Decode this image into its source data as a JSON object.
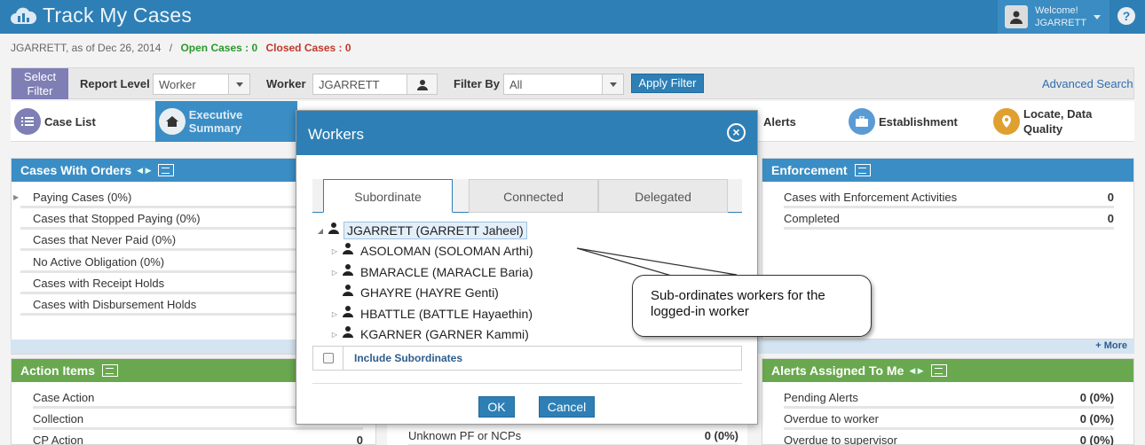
{
  "header": {
    "app_title": "Track My Cases",
    "welcome": "Welcome!",
    "username": "JGARRETT",
    "help": "?"
  },
  "subbar": {
    "as_of": "JGARRETT, as of Dec 26, 2014",
    "sep": "/",
    "open_cases": "Open Cases : 0",
    "closed_cases": "Closed Cases : 0"
  },
  "filter": {
    "select_filter": "Select Filter",
    "report_level_label": "Report Level",
    "report_level_value": "Worker",
    "worker_label": "Worker",
    "worker_value": "JGARRETT",
    "filter_by_label": "Filter By",
    "filter_by_value": "All",
    "apply": "Apply Filter",
    "advanced": "Advanced Search"
  },
  "nav": {
    "case_list": "Case List",
    "exec_summary": "Executive Summary",
    "alerts": "Alerts",
    "establishment": "Establishment",
    "locate": "Locate, Data Quality"
  },
  "panels": {
    "orders": {
      "title": "Cases With Orders",
      "rows": [
        "Paying Cases (0%)",
        "Cases that Stopped Paying (0%)",
        "Cases that Never Paid (0%)",
        "No Active Obligation (0%)",
        "Cases with Receipt Holds",
        "Cases with Disbursement Holds"
      ],
      "more": "+ More"
    },
    "enforcement": {
      "title": "Enforcement",
      "rows": [
        {
          "label": "Cases with Enforcement Activities",
          "value": "0"
        },
        {
          "label": "Completed",
          "value": "0"
        }
      ]
    },
    "action_items": {
      "title": "Action Items",
      "rows": [
        {
          "label": "Case Action",
          "value": ""
        },
        {
          "label": "Collection",
          "value": ""
        },
        {
          "label": "CP Action",
          "value": "0"
        }
      ]
    },
    "middle": {
      "rows": [
        {
          "label": "Unknown PF or NCPs",
          "value": "0 (0%)"
        }
      ]
    },
    "alerts_assigned": {
      "title": "Alerts Assigned To Me",
      "rows": [
        {
          "label": "Pending Alerts",
          "value": "0 (0%)"
        },
        {
          "label": "Overdue to worker",
          "value": "0 (0%)"
        },
        {
          "label": "Overdue to supervisor",
          "value": "0 (0%)"
        }
      ]
    }
  },
  "modal": {
    "title": "Workers",
    "tabs": [
      "Subordinate",
      "Connected",
      "Delegated"
    ],
    "tree": {
      "root": "JGARRETT (GARRETT Jaheel)",
      "children": [
        "ASOLOMAN (SOLOMAN Arthi)",
        "BMARACLE (MARACLE Baria)",
        "GHAYRE (HAYRE Genti)",
        "HBATTLE (BATTLE Hayaethin)",
        "KGARNER (GARNER Kammi)"
      ]
    },
    "include_subordinates": "Include Subordinates",
    "ok": "OK",
    "cancel": "Cancel"
  },
  "callout": {
    "text": "Sub-ordinates workers for the logged-in worker"
  },
  "colors": {
    "header_blue": "#2e7fb5",
    "panel_blue": "#3b8ec5",
    "panel_green": "#6aa84f",
    "open_green": "#2a9a2a",
    "closed_red": "#c0392b"
  }
}
